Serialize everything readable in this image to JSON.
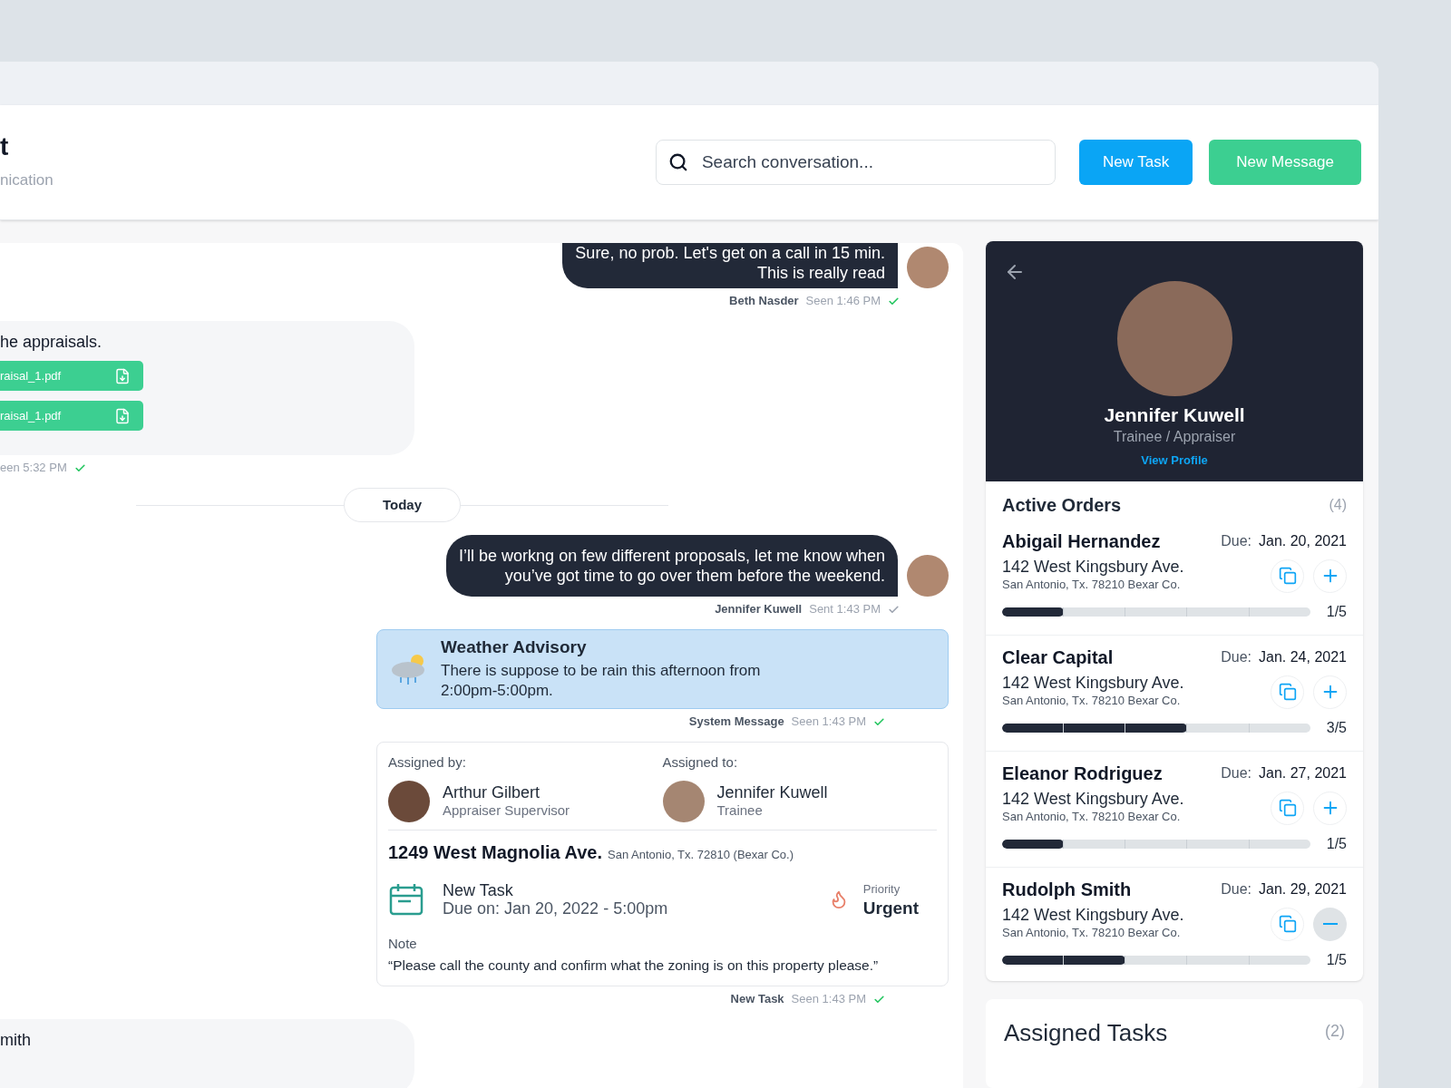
{
  "header": {
    "title": "t",
    "subtitle": "nication"
  },
  "search": {
    "placeholder": "Search conversation..."
  },
  "buttons": [
    {
      "label": "New Task",
      "kind": "task"
    },
    {
      "label": "New Message",
      "kind": "message"
    }
  ],
  "messages": [
    {
      "kind": "outgoing",
      "lines": [
        "Sure, no prob. Let's get on a call in 15 min.",
        "This is really read"
      ],
      "meta": {
        "sender": "Beth Nasder",
        "status": "Seen 1:46 PM",
        "read": true
      }
    },
    {
      "kind": "incoming",
      "text": "he appraisals.",
      "files": [
        "raisal_1.pdf",
        "raisal_1.pdf"
      ],
      "meta": {
        "status": "een 5:32 PM",
        "read": true
      }
    },
    {
      "kind": "divider",
      "label": "Today"
    },
    {
      "kind": "outgoing",
      "lines": [
        "I’ll be workng on few different proposals, let me know when",
        "you’ve got time to go over them before the weekend."
      ],
      "meta": {
        "sender": "Jennifer Kuwell",
        "status": "Sent 1:43 PM",
        "read": false
      }
    },
    {
      "kind": "system",
      "title": "Weather Advisory",
      "text": "There is suppose to be rain this afternoon from 2:00pm-5:00pm.",
      "meta": {
        "sender": "System Message",
        "status": "Seen 1:43 PM",
        "read": true
      }
    },
    {
      "kind": "task",
      "assigned_by": {
        "label": "Assigned by:",
        "name": "Arthur Gilbert",
        "role": "Appraiser Supervisor"
      },
      "assigned_to": {
        "label": "Assigned to:",
        "name": "Jennifer Kuwell",
        "role": "Trainee"
      },
      "address": "1249 West Magnolia Ave.",
      "city": "San Antonio, Tx. 72810 (Bexar Co.)",
      "title": "New Task",
      "due": "Due on: Jan 20, 2022 - 5:00pm",
      "priority_label": "Priority",
      "priority": "Urgent",
      "note_label": "Note",
      "note": "“Please call the county and confirm what the zoning is on this property please.”",
      "meta": {
        "sender": "New Task",
        "status": "Seen 1:43 PM",
        "read": true
      }
    },
    {
      "kind": "incoming",
      "text": "mith"
    }
  ],
  "profile": {
    "name": "Jennifer Kuwell",
    "role": "Trainee / Appraiser",
    "link": "View Profile"
  },
  "active_orders": {
    "title": "Active Orders",
    "count": "(4)",
    "items": [
      {
        "name": "Abigail Hernandez",
        "due_label": "Due:",
        "due": "Jan. 20, 2021",
        "street": "142 West Kingsbury Ave.",
        "city": "San Antonio, Tx. 78210 Bexar Co.",
        "level": 0.2,
        "progress": "1/5",
        "expanded": false
      },
      {
        "name": "Clear Capital",
        "due_label": "Due:",
        "due": "Jan. 24, 2021",
        "street": "142 West Kingsbury Ave.",
        "city": "San Antonio, Tx. 78210 Bexar Co.",
        "level": 0.6,
        "progress": "3/5",
        "expanded": false
      },
      {
        "name": "Eleanor Rodriguez",
        "due_label": "Due:",
        "due": "Jan. 27, 2021",
        "street": "142 West Kingsbury Ave.",
        "city": "San Antonio, Tx. 78210 Bexar Co.",
        "level": 0.2,
        "progress": "1/5",
        "expanded": false
      },
      {
        "name": "Rudolph Smith",
        "due_label": "Due:",
        "due": "Jan. 29, 2021",
        "street": "142 West Kingsbury Ave.",
        "city": "San Antonio, Tx. 78210 Bexar Co.",
        "level": 0.4,
        "progress": "1/5",
        "expanded": true
      }
    ]
  },
  "assigned_tasks": {
    "title": "Assigned Tasks",
    "count": "(2)"
  }
}
